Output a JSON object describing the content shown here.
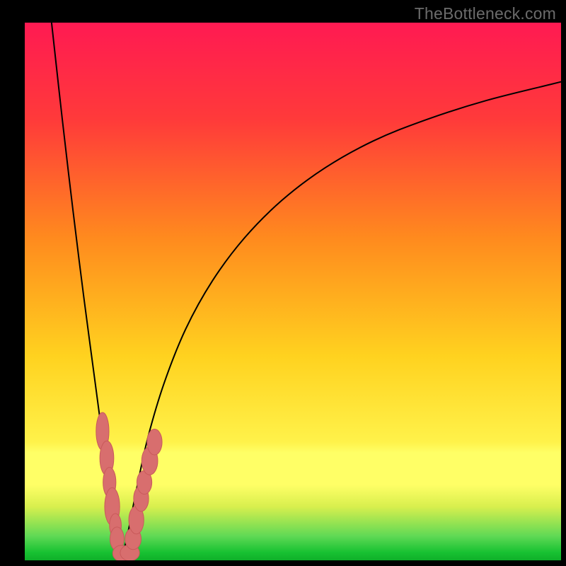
{
  "watermark": "TheBottleneck.com",
  "layout": {
    "outer_w": 800,
    "outer_h": 800,
    "inner_left": 35,
    "inner_top": 32,
    "inner_w": 758,
    "inner_h": 760
  },
  "colors": {
    "bg_black": "#000000",
    "curve": "#000000",
    "marker_fill": "#d86e6e",
    "marker_stroke": "#c85a5a",
    "grad_top": "#ff1a52",
    "grad_mid1": "#ff6a2e",
    "grad_mid2": "#ffd21f",
    "grad_band": "#ffff66",
    "grad_green": "#1fd33f",
    "grad_green2": "#0fbf30"
  },
  "gradient_stops": [
    {
      "offset": 0.0,
      "color": "#ff1a52"
    },
    {
      "offset": 0.18,
      "color": "#ff3a3a"
    },
    {
      "offset": 0.4,
      "color": "#ff8a1e"
    },
    {
      "offset": 0.62,
      "color": "#ffd21f"
    },
    {
      "offset": 0.78,
      "color": "#fff24a"
    },
    {
      "offset": 0.8,
      "color": "#ffff66"
    },
    {
      "offset": 0.86,
      "color": "#ffff66"
    },
    {
      "offset": 0.9,
      "color": "#d8ef4e"
    },
    {
      "offset": 0.955,
      "color": "#5fd955"
    },
    {
      "offset": 0.985,
      "color": "#18c232"
    },
    {
      "offset": 1.0,
      "color": "#0faf29"
    }
  ],
  "chart_data": {
    "type": "line",
    "title": "",
    "xlabel": "",
    "ylabel": "",
    "xlim": [
      0,
      100
    ],
    "ylim": [
      0,
      100
    ],
    "x_min_at": 18,
    "series": [
      {
        "name": "left-branch",
        "x": [
          5,
          7,
          9,
          11,
          13,
          15,
          16,
          17,
          18
        ],
        "y": [
          100,
          82,
          65,
          49,
          34,
          19,
          12,
          5,
          0
        ]
      },
      {
        "name": "right-branch",
        "x": [
          18,
          19,
          20,
          21,
          23,
          26,
          30,
          35,
          41,
          48,
          56,
          65,
          75,
          86,
          98,
          100
        ],
        "y": [
          0,
          4,
          9,
          14,
          23,
          33,
          43,
          52,
          60,
          67,
          73,
          78,
          82,
          85.5,
          88.5,
          89
        ]
      }
    ],
    "markers": [
      {
        "x": 14.5,
        "y": 24,
        "rx": 1.2,
        "ry": 3.5
      },
      {
        "x": 15.3,
        "y": 19,
        "rx": 1.3,
        "ry": 3.2
      },
      {
        "x": 15.8,
        "y": 14.5,
        "rx": 1.2,
        "ry": 2.8
      },
      {
        "x": 16.3,
        "y": 10,
        "rx": 1.4,
        "ry": 3.5
      },
      {
        "x": 16.9,
        "y": 6.5,
        "rx": 1.1,
        "ry": 2.2
      },
      {
        "x": 17.2,
        "y": 4.0,
        "rx": 1.3,
        "ry": 2.2
      },
      {
        "x": 18.0,
        "y": 1.3,
        "rx": 1.6,
        "ry": 1.5
      },
      {
        "x": 19.6,
        "y": 1.4,
        "rx": 1.8,
        "ry": 1.5
      },
      {
        "x": 20.2,
        "y": 4,
        "rx": 1.5,
        "ry": 2.0
      },
      {
        "x": 20.8,
        "y": 7.5,
        "rx": 1.4,
        "ry": 2.6
      },
      {
        "x": 21.7,
        "y": 11.5,
        "rx": 1.4,
        "ry": 2.4
      },
      {
        "x": 22.3,
        "y": 14.5,
        "rx": 1.4,
        "ry": 2.2
      },
      {
        "x": 23.3,
        "y": 18.5,
        "rx": 1.5,
        "ry": 2.6
      },
      {
        "x": 24.2,
        "y": 22.0,
        "rx": 1.4,
        "ry": 2.4
      }
    ]
  }
}
